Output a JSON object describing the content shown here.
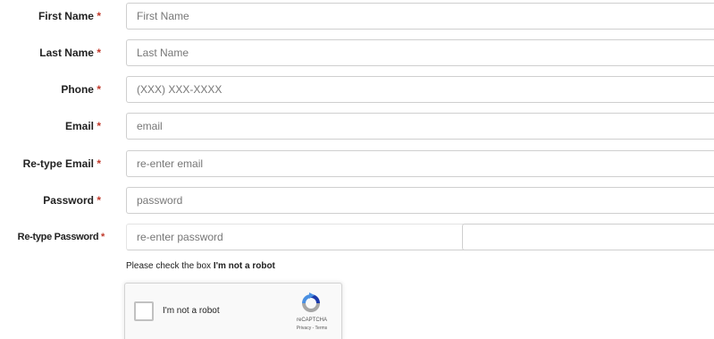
{
  "fields": [
    {
      "label": "First Name",
      "required_mark": "*",
      "placeholder": "First Name",
      "value": ""
    },
    {
      "label": "Last Name",
      "required_mark": "*",
      "placeholder": "Last Name",
      "value": ""
    },
    {
      "label": "Phone",
      "required_mark": "*",
      "placeholder": "(XXX) XXX-XXXX",
      "value": ""
    },
    {
      "label": "Email",
      "required_mark": "*",
      "placeholder": "email",
      "value": ""
    },
    {
      "label": "Re-type Email",
      "required_mark": "*",
      "placeholder": "re-enter email",
      "value": ""
    },
    {
      "label": "Password",
      "required_mark": "*",
      "placeholder": "password",
      "value": ""
    },
    {
      "label": "Re-type Password",
      "required_mark": "*",
      "placeholder": "re-enter password",
      "value": ""
    }
  ],
  "captcha": {
    "instruction_prefix": "Please check the box",
    "instruction_emphasis": "I'm not a robot",
    "checkbox_label": "I'm not a robot",
    "brand": "reCAPTCHA",
    "links": "Privacy - Terms",
    "checked": false
  },
  "colors": {
    "required": "#c0392b",
    "input_border": "#cfcfcf",
    "recaptcha_blue": "#4a90e2",
    "recaptcha_gray": "#a6a6a6"
  }
}
